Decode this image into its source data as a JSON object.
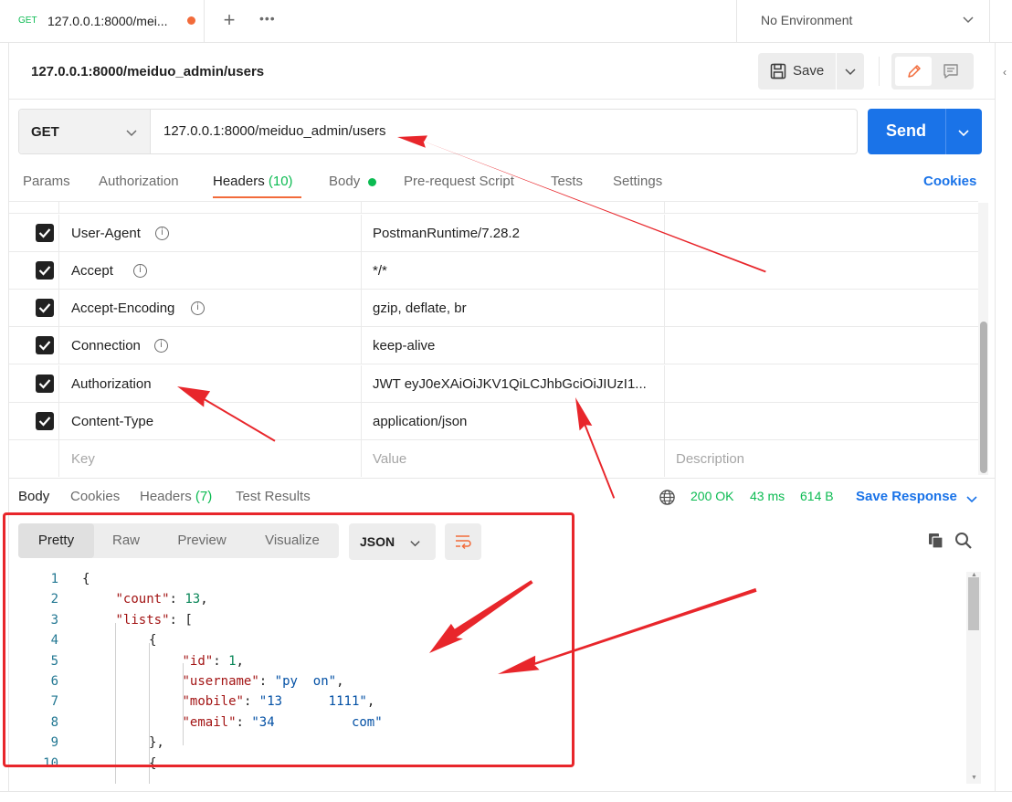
{
  "tab": {
    "method": "GET",
    "title": "127.0.0.1:8000/mei...",
    "new_tab": "+",
    "more": "•••"
  },
  "environment": {
    "label": "No Environment"
  },
  "request": {
    "name": "127.0.0.1:8000/meiduo_admin/users",
    "save_label": "Save",
    "method": "GET",
    "url": "127.0.0.1:8000/meiduo_admin/users",
    "send_label": "Send"
  },
  "request_tabs": [
    {
      "label": "Params"
    },
    {
      "label": "Authorization"
    },
    {
      "label": "Headers",
      "count": "(10)"
    },
    {
      "label": "Body"
    },
    {
      "label": "Pre-request Script"
    },
    {
      "label": "Tests"
    },
    {
      "label": "Settings"
    }
  ],
  "cookies_link": "Cookies",
  "headers_rows": [
    {
      "key": "User-Agent",
      "value": "PostmanRuntime/7.28.2",
      "checked": true,
      "info": true
    },
    {
      "key": "Accept",
      "value": "*/*",
      "checked": true,
      "info": true
    },
    {
      "key": "Accept-Encoding",
      "value": "gzip, deflate, br",
      "checked": true,
      "info": true
    },
    {
      "key": "Connection",
      "value": "keep-alive",
      "checked": true,
      "info": true
    },
    {
      "key": "Authorization",
      "value": "JWT eyJ0eXAiOiJKV1QiLCJhbGciOiJIUzI1...",
      "checked": true,
      "info": false
    },
    {
      "key": "Content-Type",
      "value": "application/json",
      "checked": true,
      "info": false
    }
  ],
  "headers_placeholder": {
    "key": "Key",
    "value": "Value",
    "description": "Description"
  },
  "response": {
    "tabs": [
      {
        "label": "Body"
      },
      {
        "label": "Cookies"
      },
      {
        "label": "Headers",
        "count": "(7)"
      },
      {
        "label": "Test Results"
      }
    ],
    "status": "200 OK",
    "time": "43 ms",
    "size": "614 B",
    "save_response": "Save Response",
    "views": [
      "Pretty",
      "Raw",
      "Preview",
      "Visualize"
    ],
    "format": "JSON"
  },
  "code_lines": [
    {
      "n": "1",
      "indent": 0,
      "parts": [
        [
          "p",
          "{"
        ]
      ]
    },
    {
      "n": "2",
      "indent": 1,
      "parts": [
        [
          "k",
          "\"count\""
        ],
        [
          "p",
          ": "
        ],
        [
          "n",
          "13"
        ],
        [
          "p",
          ","
        ]
      ]
    },
    {
      "n": "3",
      "indent": 1,
      "parts": [
        [
          "k",
          "\"lists\""
        ],
        [
          "p",
          ": ["
        ]
      ]
    },
    {
      "n": "4",
      "indent": 2,
      "parts": [
        [
          "p",
          "{"
        ]
      ]
    },
    {
      "n": "5",
      "indent": 3,
      "parts": [
        [
          "k",
          "\"id\""
        ],
        [
          "p",
          ": "
        ],
        [
          "n",
          "1"
        ],
        [
          "p",
          ","
        ]
      ]
    },
    {
      "n": "6",
      "indent": 3,
      "parts": [
        [
          "k",
          "\"username\""
        ],
        [
          "p",
          ": "
        ],
        [
          "s",
          "\"py  on\""
        ],
        [
          "p",
          ","
        ]
      ]
    },
    {
      "n": "7",
      "indent": 3,
      "parts": [
        [
          "k",
          "\"mobile\""
        ],
        [
          "p",
          ": "
        ],
        [
          "s",
          "\"13      1111\""
        ],
        [
          "p",
          ","
        ]
      ]
    },
    {
      "n": "8",
      "indent": 3,
      "parts": [
        [
          "k",
          "\"email\""
        ],
        [
          "p",
          ": "
        ],
        [
          "s",
          "\"34          com\""
        ]
      ]
    },
    {
      "n": "9",
      "indent": 2,
      "parts": [
        [
          "p",
          "},"
        ]
      ]
    },
    {
      "n": "10",
      "indent": 2,
      "parts": [
        [
          "p",
          "{"
        ]
      ]
    }
  ],
  "colors": {
    "accent": "#1a73e8",
    "success": "#0cbb52",
    "tab_indicator": "#f26b3a",
    "annotation": "#e8262b"
  }
}
